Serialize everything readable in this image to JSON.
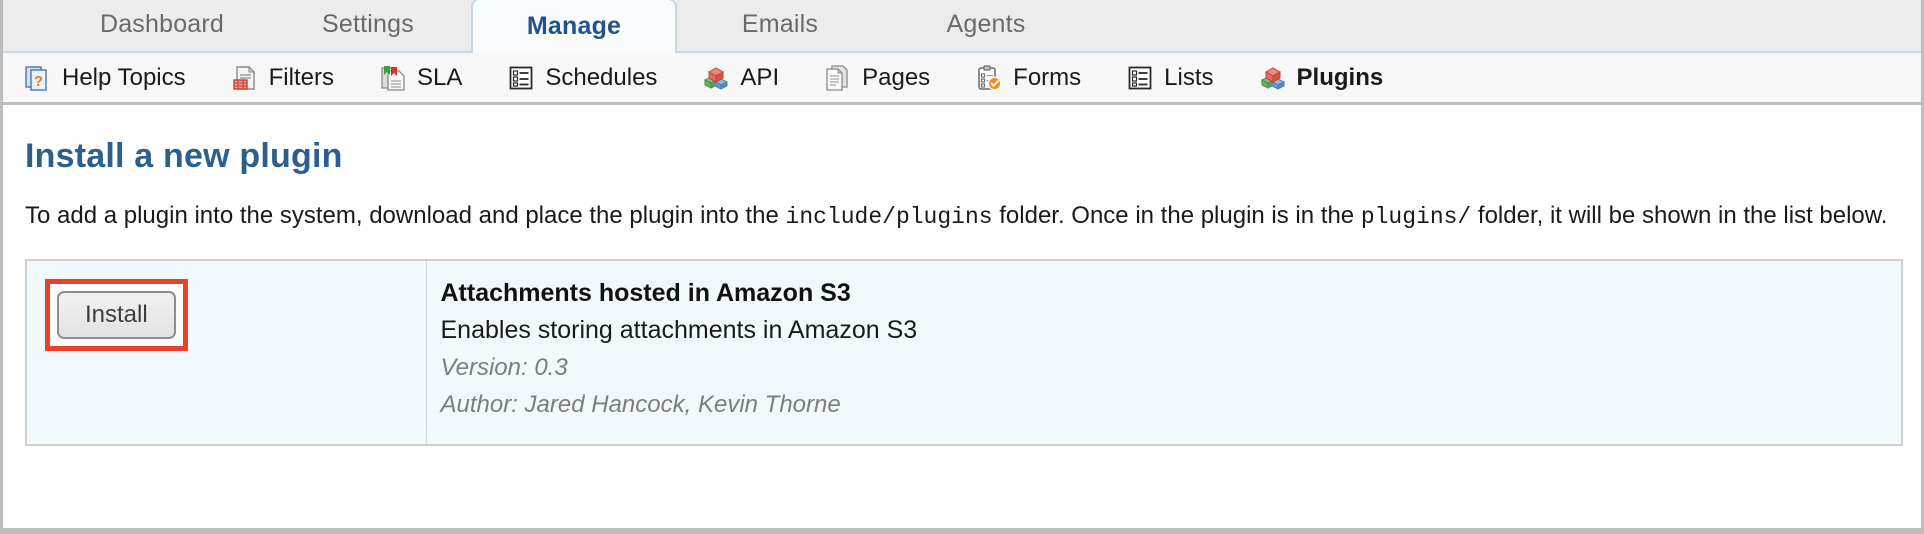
{
  "tabs": [
    {
      "label": "Dashboard",
      "active": false
    },
    {
      "label": "Settings",
      "active": false
    },
    {
      "label": "Manage",
      "active": true
    },
    {
      "label": "Emails",
      "active": false
    },
    {
      "label": "Agents",
      "active": false
    }
  ],
  "subnav": [
    {
      "label": "Help Topics",
      "icon": "help-topics-icon",
      "active": false
    },
    {
      "label": "Filters",
      "icon": "filters-icon",
      "active": false
    },
    {
      "label": "SLA",
      "icon": "sla-icon",
      "active": false
    },
    {
      "label": "Schedules",
      "icon": "schedules-icon",
      "active": false
    },
    {
      "label": "API",
      "icon": "api-icon",
      "active": false
    },
    {
      "label": "Pages",
      "icon": "pages-icon",
      "active": false
    },
    {
      "label": "Forms",
      "icon": "forms-icon",
      "active": false
    },
    {
      "label": "Lists",
      "icon": "lists-icon",
      "active": false
    },
    {
      "label": "Plugins",
      "icon": "plugins-icon",
      "active": true
    }
  ],
  "main": {
    "title": "Install a new plugin",
    "intro": {
      "part1": "To add a plugin into the system, download and place the plugin into the ",
      "code1": "include/plugins",
      "part2": " folder. Once in the plugin is in the ",
      "code2": "plugins/",
      "part3": " folder, it will be shown in the list below."
    }
  },
  "plugin_rows": [
    {
      "action_label": "Install",
      "name": "Attachments hosted in Amazon S3",
      "description": "Enables storing attachments in Amazon S3",
      "version": "Version: 0.3",
      "author": "Author: Jared Hancock, Kevin Thorne"
    }
  ],
  "colors": {
    "accent_heading": "#2c5f8e",
    "active_tab_text": "#20538d",
    "highlight_box": "#e8432a",
    "row_background": "#f2f9fc"
  }
}
